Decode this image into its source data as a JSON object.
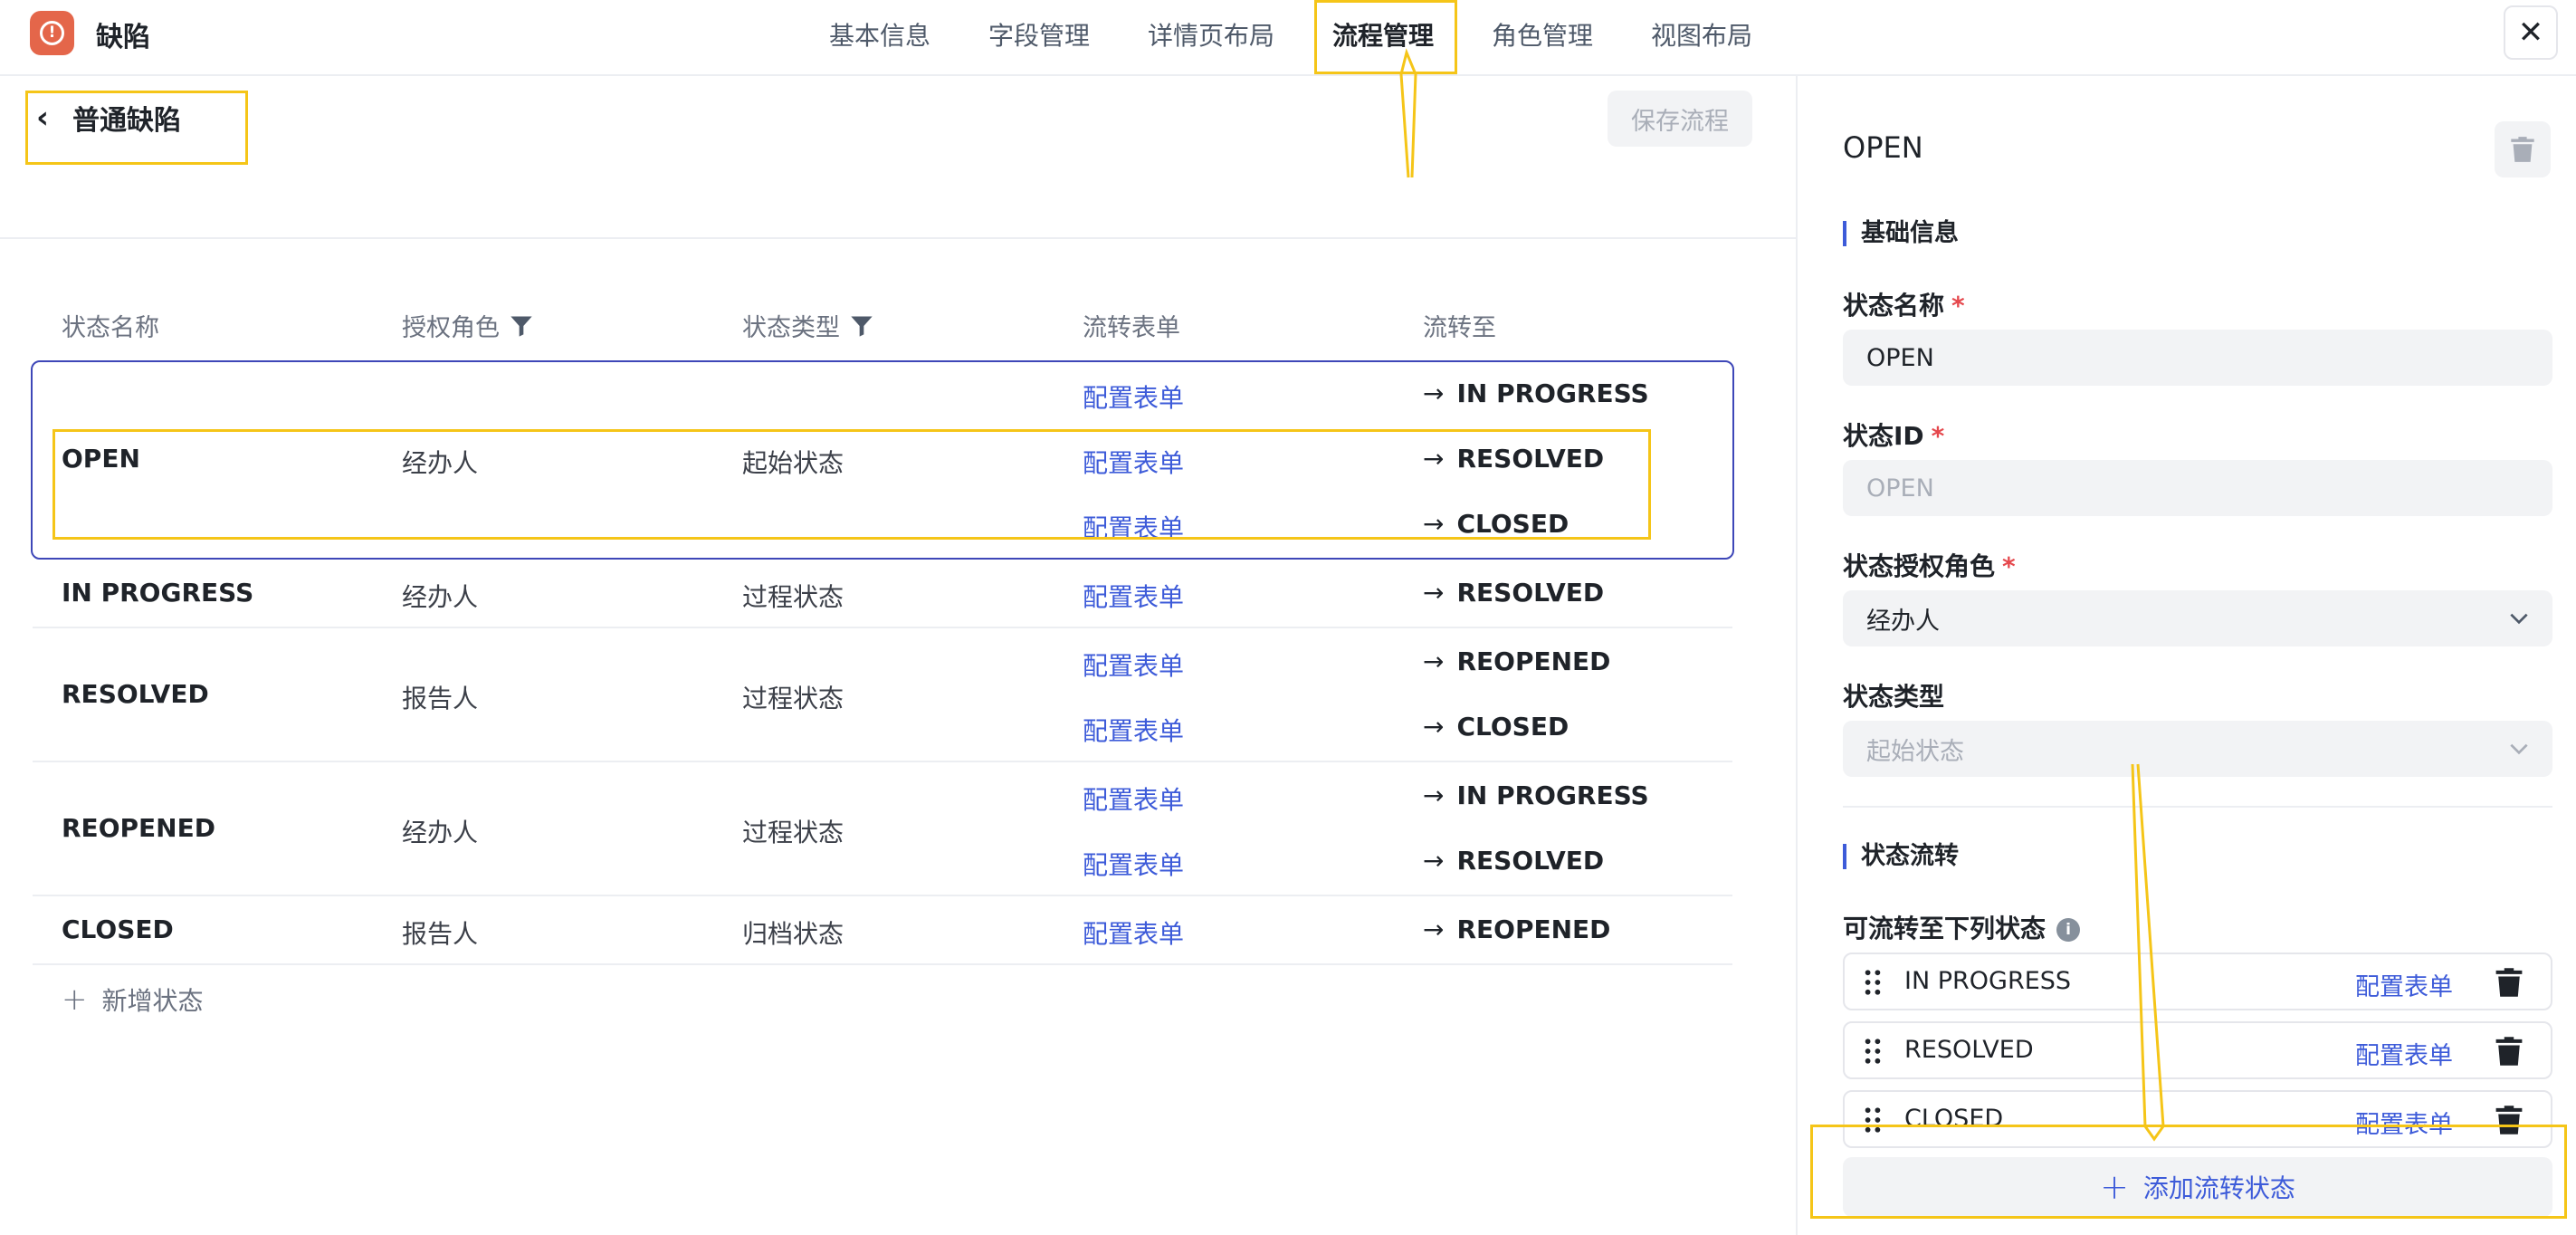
{
  "header": {
    "app_title": "缺陷",
    "logo_glyph": "!",
    "tabs": [
      {
        "label": "基本信息",
        "active": false
      },
      {
        "label": "字段管理",
        "active": false
      },
      {
        "label": "详情页布局",
        "active": false
      },
      {
        "label": "流程管理",
        "active": true
      },
      {
        "label": "角色管理",
        "active": false
      },
      {
        "label": "视图布局",
        "active": false
      }
    ],
    "close_glyph": "✕"
  },
  "workflow": {
    "back_glyph": "‹",
    "title": "普通缺陷",
    "save_label": "保存流程",
    "columns": [
      "状态名称",
      "授权角色",
      "状态类型",
      "流转表单",
      "流转至"
    ],
    "link_label": "配置表单",
    "arrow_glyph": "→",
    "rows": [
      {
        "name": "OPEN",
        "role": "经办人",
        "type": "起始状态",
        "targets": [
          "IN PROGRESS",
          "RESOLVED",
          "CLOSED"
        ]
      },
      {
        "name": "IN PROGRESS",
        "role": "经办人",
        "type": "过程状态",
        "targets": [
          "RESOLVED"
        ]
      },
      {
        "name": "RESOLVED",
        "role": "报告人",
        "type": "过程状态",
        "targets": [
          "REOPENED",
          "CLOSED"
        ]
      },
      {
        "name": "REOPENED",
        "role": "经办人",
        "type": "过程状态",
        "targets": [
          "IN PROGRESS",
          "RESOLVED"
        ]
      },
      {
        "name": "CLOSED",
        "role": "报告人",
        "type": "归档状态",
        "targets": [
          "REOPENED"
        ]
      }
    ],
    "add_state_label": "新增状态"
  },
  "detail": {
    "title": "OPEN",
    "basic_section": "基础信息",
    "name_label": "状态名称",
    "name_value": "OPEN",
    "id_label": "状态ID",
    "id_value": "OPEN",
    "role_label": "状态授权角色",
    "role_value": "经办人",
    "type_label": "状态类型",
    "type_value": "起始状态",
    "required_mark": "*",
    "flow_section": "状态流转",
    "transitions_label": "可流转至下列状态",
    "info_glyph": "i",
    "transitions": [
      "IN PROGRESS",
      "RESOLVED",
      "CLOSED"
    ],
    "config_link": "配置表单",
    "add_transition_label": "添加流转状态",
    "plus_glyph": "+"
  },
  "colors": {
    "accent": "#3d5bd9",
    "logo": "#e4664a",
    "annotation": "#f5c518",
    "selected_row_outline": "#3e47b8",
    "required": "#e5484d"
  }
}
